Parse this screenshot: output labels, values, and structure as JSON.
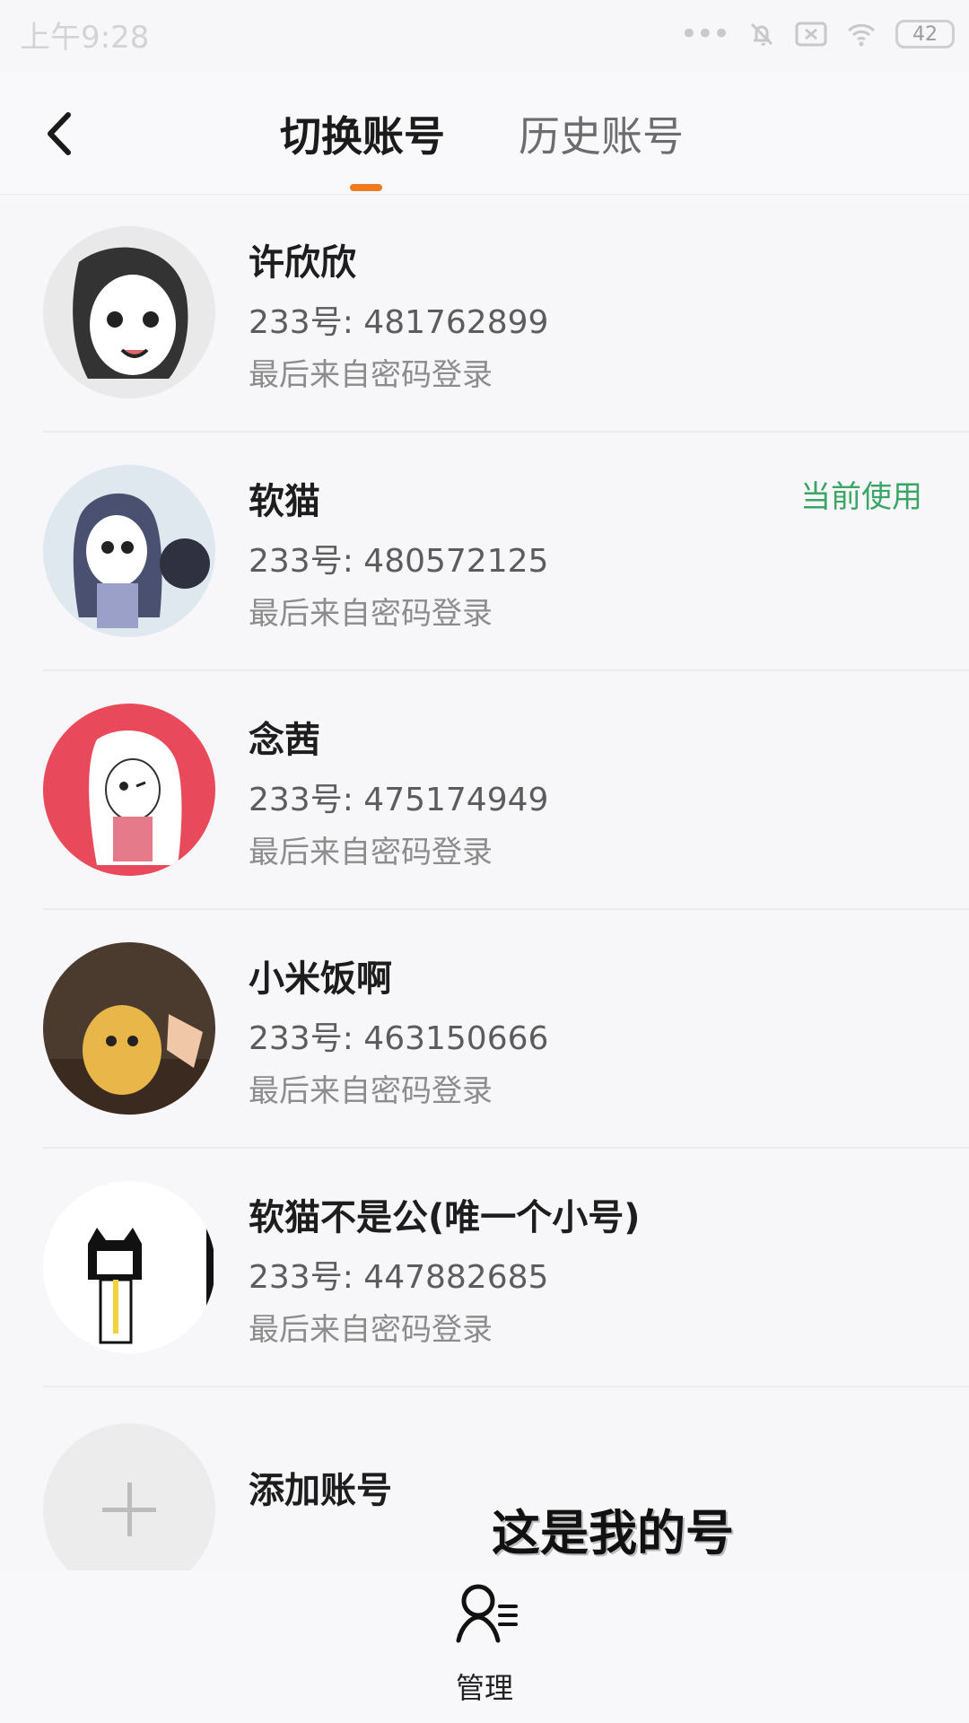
{
  "status_bar": {
    "time": "上午9:28",
    "battery": "42"
  },
  "header": {
    "back_icon": "chevron-left-icon",
    "tab_switch": "切换账号",
    "tab_history": "历史账号",
    "accent_color": "#f07b1f"
  },
  "accounts": [
    {
      "name": "许欣欣",
      "account": "233号: 481762899",
      "login": "最后来自密码登录",
      "current": ""
    },
    {
      "name": "软猫",
      "account": "233号: 480572125",
      "login": "最后来自密码登录",
      "current": "当前使用"
    },
    {
      "name": "念茜",
      "account": "233号: 475174949",
      "login": "最后来自密码登录",
      "current": ""
    },
    {
      "name": "小米饭啊",
      "account": "233号: 463150666",
      "login": "最后来自密码登录",
      "current": ""
    },
    {
      "name": "软猫不是公(唯一个小号)",
      "account": "233号: 447882685",
      "login": "最后来自密码登录",
      "current": ""
    }
  ],
  "add_account": {
    "label": "添加账号"
  },
  "overlay": {
    "caption": "这是我的号"
  },
  "bottom": {
    "manage_label": "管理",
    "manage_icon": "user-manage-icon"
  },
  "colors": {
    "current_status": "#3aa564"
  }
}
